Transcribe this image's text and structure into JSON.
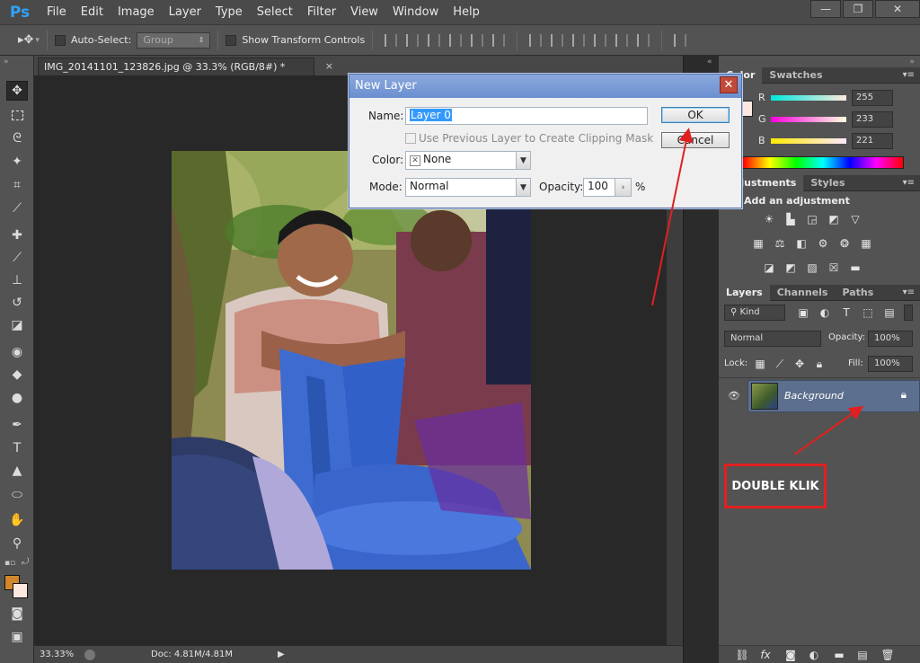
{
  "app": {
    "logo": "Ps"
  },
  "menu": [
    "File",
    "Edit",
    "Image",
    "Layer",
    "Type",
    "Select",
    "Filter",
    "View",
    "Window",
    "Help"
  ],
  "window_controls": {
    "minimize": "—",
    "restore": "❐",
    "close": "✕"
  },
  "options_bar": {
    "auto_select_label": "Auto-Select:",
    "auto_select_value": "Group",
    "transform_label": "Show Transform Controls"
  },
  "document": {
    "tab_title": "IMG_20141101_123826.jpg @ 33.3% (RGB/8#) *",
    "tab_close": "×"
  },
  "status": {
    "zoom": "33.33%",
    "doc_size": "Doc: 4.81M/4.81M"
  },
  "color_panel": {
    "tabs": [
      "Color",
      "Swatches"
    ],
    "active_tab": "Color",
    "r_label": "R",
    "g_label": "G",
    "b_label": "B",
    "r": "255",
    "g": "233",
    "b": "221"
  },
  "adjustments_panel": {
    "tabs": [
      "Adjustments",
      "Styles"
    ],
    "hint": "Add an adjustment"
  },
  "layers_panel": {
    "tabs": [
      "Layers",
      "Channels",
      "Paths"
    ],
    "filter_kind": "Kind",
    "blend_mode": "Normal",
    "opacity_label": "Opacity:",
    "opacity": "100%",
    "lock_label": "Lock:",
    "fill_label": "Fill:",
    "fill": "100%",
    "layers": [
      {
        "name": "Background",
        "locked": true
      }
    ]
  },
  "dialog": {
    "title": "New Layer",
    "name_label": "Name:",
    "name_value": "Layer 0",
    "clip_label": "Use Previous Layer to Create Clipping Mask",
    "color_label": "Color:",
    "color_value": "None",
    "mode_label": "Mode:",
    "mode_value": "Normal",
    "opacity_label": "Opacity:",
    "opacity_value": "100",
    "percent": "%",
    "ok": "OK",
    "cancel": "Cancel"
  },
  "annotation": {
    "label": "DOUBLE KLIK",
    "color": "#e02020"
  },
  "colors": {
    "foreground": "#d2872a",
    "background": "#fde8e0"
  }
}
